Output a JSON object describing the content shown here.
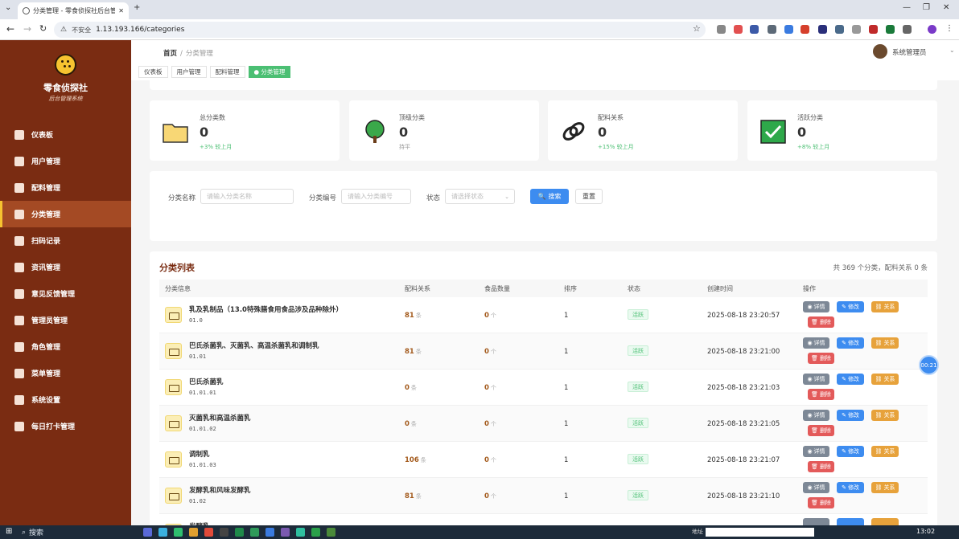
{
  "browser": {
    "tab_title": "分类管理 - 零食侦探社后台管理",
    "tab_close": "✕",
    "new_tab": "+",
    "insecure_label": "不安全",
    "url": "1.13.193.166/categories",
    "controls": {
      "minimize": "—",
      "maximize": "❐",
      "close": "✕"
    }
  },
  "sidebar": {
    "brand": "零食侦探社",
    "brand_sub": "后台管理系统",
    "items": [
      {
        "label": "仪表板",
        "icon": "chart-icon"
      },
      {
        "label": "用户管理",
        "icon": "user-icon"
      },
      {
        "label": "配料管理",
        "icon": "ingredient-icon"
      },
      {
        "label": "分类管理",
        "icon": "folder-icon",
        "active": true
      },
      {
        "label": "扫码记录",
        "icon": "scan-icon"
      },
      {
        "label": "资讯管理",
        "icon": "news-icon"
      },
      {
        "label": "意见反馈管理",
        "icon": "feedback-icon"
      },
      {
        "label": "管理员管理",
        "icon": "admin-icon"
      },
      {
        "label": "角色管理",
        "icon": "role-icon"
      },
      {
        "label": "菜单管理",
        "icon": "menu-icon"
      },
      {
        "label": "系统设置",
        "icon": "settings-icon"
      },
      {
        "label": "每日打卡管理",
        "icon": "calendar-icon"
      }
    ]
  },
  "header": {
    "breadcrumb_home": "首页",
    "breadcrumb_sep": "/",
    "breadcrumb_current": "分类管理",
    "user_name": "系统管理员",
    "tags": [
      {
        "label": "仪表板"
      },
      {
        "label": "用户管理"
      },
      {
        "label": "配料管理"
      },
      {
        "label": "● 分类管理",
        "active": true
      }
    ]
  },
  "stats": [
    {
      "title": "总分类数",
      "value": "0",
      "trend": "+3% 较上月",
      "icon": "folder-icon"
    },
    {
      "title": "顶级分类",
      "value": "0",
      "trend": "持平",
      "icon": "tree-icon"
    },
    {
      "title": "配料关系",
      "value": "0",
      "trend": "+15% 较上月",
      "icon": "link-icon"
    },
    {
      "title": "活跃分类",
      "value": "0",
      "trend": "+8% 较上月",
      "icon": "check-icon"
    }
  ],
  "filter": {
    "name_label": "分类名称",
    "name_placeholder": "请输入分类名称",
    "code_label": "分类编号",
    "code_placeholder": "请输入分类编号",
    "status_label": "状态",
    "status_placeholder": "请选择状态",
    "search_button": "搜索",
    "reset_button": "重置"
  },
  "list": {
    "title": "分类列表",
    "summary": "共 369 个分类，配料关系 0 条",
    "columns": [
      "分类信息",
      "配料关系",
      "食品数量",
      "排序",
      "状态",
      "创建时间",
      "操作"
    ],
    "rel_unit": "条",
    "food_unit": "个",
    "actions": {
      "detail": "详情",
      "edit": "修改",
      "relation": "关系",
      "delete": "删除"
    },
    "rows": [
      {
        "name": "乳及乳制品（13.0特殊膳食用食品涉及品种除外）",
        "code": "01.0",
        "relations": "81",
        "foods": "0",
        "sort": "1",
        "status": "活跃",
        "created": "2025-08-18 23:20:57"
      },
      {
        "name": "巴氏杀菌乳、灭菌乳、高温杀菌乳和调制乳",
        "code": "01.01",
        "relations": "81",
        "foods": "0",
        "sort": "1",
        "status": "活跃",
        "created": "2025-08-18 23:21:00"
      },
      {
        "name": "巴氏杀菌乳",
        "code": "01.01.01",
        "relations": "0",
        "foods": "0",
        "sort": "1",
        "status": "活跃",
        "created": "2025-08-18 23:21:03"
      },
      {
        "name": "灭菌乳和高温杀菌乳",
        "code": "01.01.02",
        "relations": "0",
        "foods": "0",
        "sort": "1",
        "status": "活跃",
        "created": "2025-08-18 23:21:05"
      },
      {
        "name": "调制乳",
        "code": "01.01.03",
        "relations": "106",
        "foods": "0",
        "sort": "1",
        "status": "活跃",
        "created": "2025-08-18 23:21:07"
      },
      {
        "name": "发酵乳和风味发酵乳",
        "code": "01.02",
        "relations": "81",
        "foods": "0",
        "sort": "1",
        "status": "活跃",
        "created": "2025-08-18 23:21:10"
      },
      {
        "name": "发酵乳",
        "code": "",
        "relations": "",
        "foods": "",
        "sort": "",
        "status": "",
        "created": ""
      }
    ]
  },
  "float_timer": "00:21",
  "taskbar": {
    "search": "搜索",
    "addr_label": "地址",
    "time": "13:02"
  },
  "colors": {
    "sidebar": "#7a2c12",
    "accent_yellow": "#f6c330",
    "primary_blue": "#3d8cf0",
    "success_green": "#4bbf73",
    "danger_red": "#e35a5a",
    "warning_orange": "#e7a23b"
  }
}
